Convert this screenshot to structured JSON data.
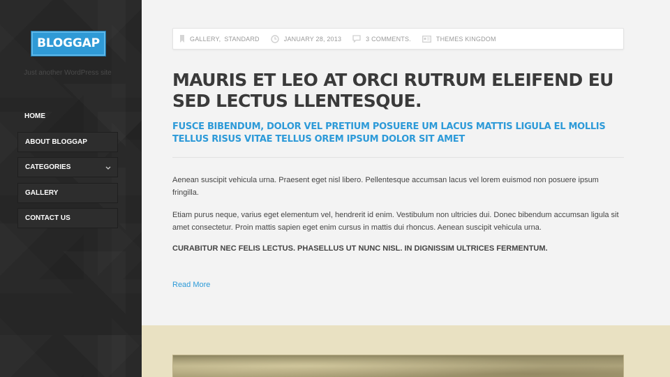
{
  "site": {
    "logo": "BLOGGAP",
    "tagline": "Just another WordPress site"
  },
  "nav": {
    "items": [
      {
        "label": "HOME"
      },
      {
        "label": "ABOUT BLOGGAP"
      },
      {
        "label": "CATEGORIES",
        "has_submenu": true
      },
      {
        "label": "GALLERY"
      },
      {
        "label": "CONTACT US"
      }
    ]
  },
  "post": {
    "meta": {
      "categories": [
        "GALLERY,",
        "STANDARD"
      ],
      "date": "JANUARY 28, 2013",
      "comments": "3 COMMENTS.",
      "author": "THEMES KINGDOM"
    },
    "title": "MAURIS ET LEO AT ORCI RUTRUM ELEIFEND EU SED LECTUS LLENTESQUE.",
    "subtitle": "FUSCE BIBENDUM, DOLOR VEL PRETIUM POSUERE UM LACUS MATTIS LIGULA EL MOLLIS TELLUS RISUS VITAE TELLUS OREM IPSUM DOLOR SIT AMET",
    "paragraphs": [
      "Aenean suscipit vehicula urna. Praesent eget nisl libero. Pellentesque accumsan lacus vel lorem euismod non posuere ipsum fringilla.",
      "Etiam purus neque, varius eget elementum vel, hendrerit id enim. Vestibulum non ultricies dui. Donec bibendum accumsan ligula sit amet consectetur. Proin mattis sapien eget enim cursus in mattis dui rhoncus. Aenean suscipit vehicula urna.",
      "CURABITUR NEC FELIS LECTUS. PHASELLUS UT NUNC NISL. IN DIGNISSIM ULTRICES FERMENTUM."
    ],
    "read_more": "Read More"
  },
  "colors": {
    "accent": "#2d9ad8",
    "sidebar_bg": "#262626",
    "band_bg": "#e9e1c2"
  }
}
